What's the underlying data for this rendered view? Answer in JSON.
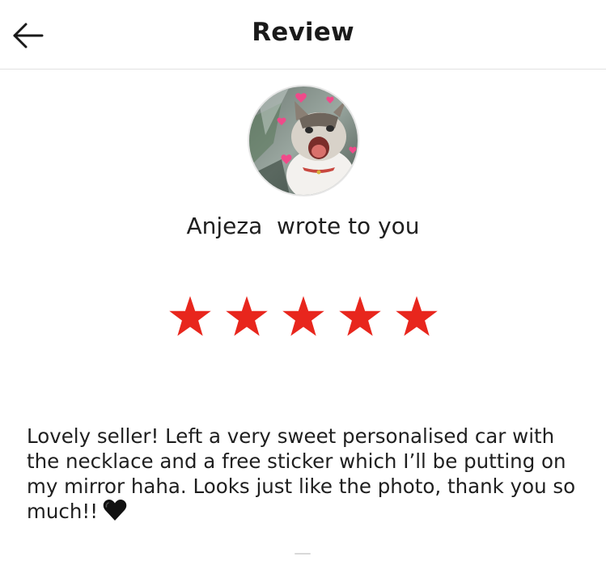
{
  "header": {
    "title": "Review",
    "back_icon": "arrow-left-icon"
  },
  "review": {
    "author": "Anjeza",
    "wrote_text": "Anjeza  wrote to you",
    "rating": 5,
    "rating_max": 5,
    "star_color": "#e8261d",
    "text": "Lovely seller! Left a very sweet personalised car with the necklace and a free sticker which I’ll be putting on my mirror haha. Looks just like the photo, thank you so much!!",
    "emoji": "black-heart-icon"
  }
}
